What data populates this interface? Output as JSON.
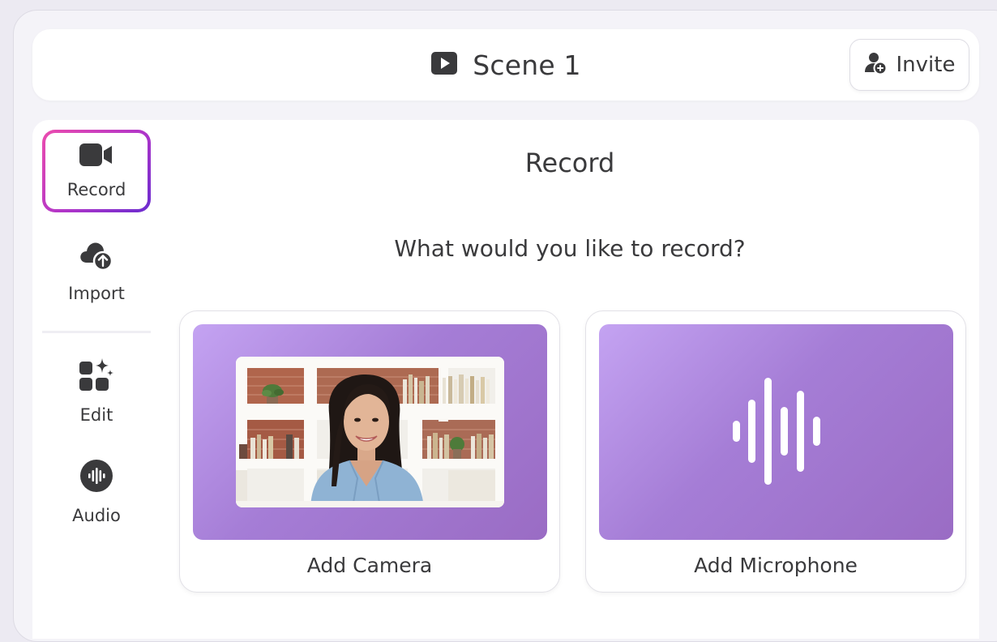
{
  "header": {
    "title": "Scene 1",
    "invite_label": "Invite"
  },
  "sidebar": {
    "items": [
      {
        "label": "Record",
        "icon": "video-camera-icon",
        "active": true
      },
      {
        "label": "Import",
        "icon": "cloud-upload-icon",
        "active": false
      },
      {
        "label": "Edit",
        "icon": "widgets-sparkle-icon",
        "active": false
      },
      {
        "label": "Audio",
        "icon": "audio-waveform-icon",
        "active": false
      }
    ]
  },
  "main": {
    "title": "Record",
    "subtitle": "What would you like to record?",
    "options": [
      {
        "label": "Add Camera",
        "visual": "camera-preview-photo"
      },
      {
        "label": "Add Microphone",
        "visual": "microphone-waveform-icon"
      }
    ]
  },
  "colors": {
    "accent_gradient_start": "#ec4cae",
    "accent_gradient_end": "#6a2ccf",
    "banner_purple": "#a57dd6",
    "text": "#3a3a3c"
  }
}
